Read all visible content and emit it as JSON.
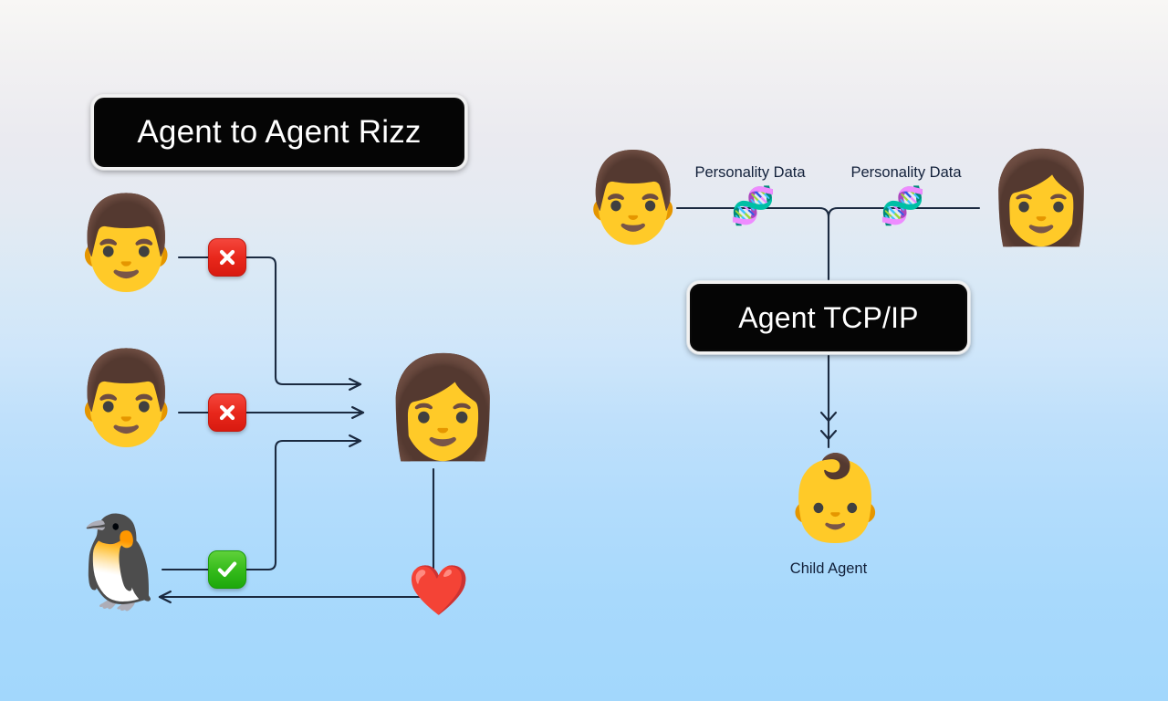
{
  "page": {
    "title": "Agent to Agent Rizz",
    "background_top": "#f8f7f5",
    "background_bottom": "#a2d7fc",
    "wire_color": "#1b2a40"
  },
  "left_panel": {
    "title_plate": {
      "label": "Agent to Agent Rizz",
      "background": "#050505",
      "text_color": "#ffffff",
      "border_color": "#f2f2f2"
    },
    "suitors": [
      {
        "id": "suitor-1",
        "icon": "man-face-emoji",
        "glyph": "👨",
        "status": "rejected",
        "status_icon": "cross-mark-icon",
        "status_color": "#e8271b"
      },
      {
        "id": "suitor-2",
        "icon": "man-face-emoji",
        "glyph": "👨",
        "status": "rejected",
        "status_icon": "cross-mark-icon",
        "status_color": "#e8271b"
      },
      {
        "id": "suitor-3",
        "icon": "penguin-face-emoji",
        "glyph": "🐧",
        "status": "accepted",
        "status_icon": "check-mark-icon",
        "status_color": "#35bb1b"
      }
    ],
    "target": {
      "id": "woman-agent",
      "icon": "woman-face-emoji",
      "glyph": "👩"
    },
    "outcome": {
      "id": "match-heart",
      "icon": "red-heart-emoji",
      "glyph": "❤️"
    }
  },
  "right_panel": {
    "parents": [
      {
        "id": "parent-male",
        "icon": "man-face-emoji",
        "glyph": "👨"
      },
      {
        "id": "parent-female",
        "icon": "woman-face-emoji",
        "glyph": "👩"
      }
    ],
    "data_links": [
      {
        "label": "Personality Data",
        "icon": "dna-emoji",
        "glyph": "🧬"
      },
      {
        "label": "Personality Data",
        "icon": "dna-emoji",
        "glyph": "🧬"
      }
    ],
    "protocol_plate": {
      "label": "Agent TCP/IP",
      "background": "#050505",
      "text_color": "#ffffff",
      "border_color": "#f2f2f2"
    },
    "output": {
      "id": "child-agent",
      "icon": "baby-face-emoji",
      "glyph": "👶",
      "label": "Child Agent"
    }
  }
}
